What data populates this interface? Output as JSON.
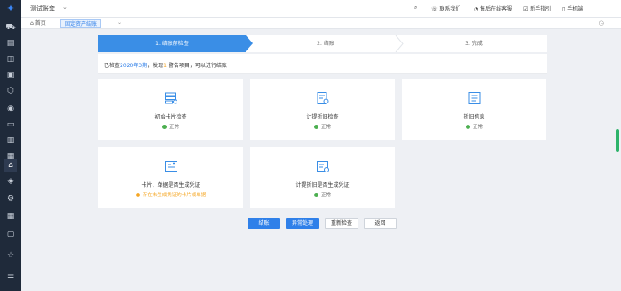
{
  "header": {
    "account": "测试账套",
    "links": [
      "联系我们",
      "售后在线客服",
      "新手指引",
      "手机端"
    ]
  },
  "tabs": [
    {
      "label": "首页"
    },
    {
      "label": "固定资产结账"
    }
  ],
  "wizard": {
    "steps": [
      "1. 结账前检查",
      "2. 结账",
      "3. 完成"
    ],
    "active": 0
  },
  "notice": {
    "prefix": "已检查",
    "period": "2020年3期",
    "middle": "，发现",
    "warn_count": "1",
    "suffix": "警告项目，可以进行结账"
  },
  "checks": [
    {
      "title": "初始卡片检查",
      "status": "正常",
      "state": "ok",
      "icon": "card-search-icon"
    },
    {
      "title": "计提折旧检查",
      "status": "正常",
      "state": "ok",
      "icon": "depreciation-check-icon"
    },
    {
      "title": "折旧信息",
      "status": "正常",
      "state": "ok",
      "icon": "depreciation-info-icon"
    },
    {
      "title": "卡片、单据是否生成凭证",
      "status": "存在未生成凭证的卡片或单据",
      "state": "warn",
      "icon": "voucher-card-icon"
    },
    {
      "title": "计提折旧是否生成凭证",
      "status": "正常",
      "state": "ok",
      "icon": "voucher-depreciation-icon"
    }
  ],
  "buttons": {
    "close": "结账",
    "handle": "异常处理",
    "recheck": "重新检查",
    "back": "返回"
  },
  "colors": {
    "accent": "#3a8ee6",
    "ok": "#4caf50",
    "warn": "#f5a623",
    "sidebar": "#1f2a3a"
  }
}
